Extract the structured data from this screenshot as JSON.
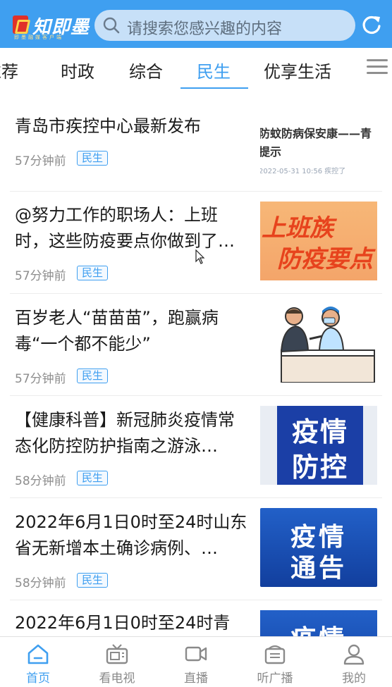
{
  "header": {
    "logo_text": "知即墨",
    "logo_subtitle": "即墨融媒客户端",
    "search_placeholder": "请搜索您感兴趣的内容"
  },
  "tabs": [
    {
      "label": "推荐",
      "active": false
    },
    {
      "label": "时政",
      "active": false
    },
    {
      "label": "综合",
      "active": false
    },
    {
      "label": "民生",
      "active": true
    },
    {
      "label": "优享生活",
      "active": false
    }
  ],
  "news": [
    {
      "title": "青岛市疾控中心最新发布",
      "time": "57分钟前",
      "tag": "民生",
      "thumb_lines": [
        "防蚊防病保安康——青",
        "提示",
        "2022-05-31 10:56 疾控了"
      ]
    },
    {
      "title": "@努力工作的职场人：上班时，这些防疫要点你做到了…",
      "time": "57分钟前",
      "tag": "民生",
      "thumb_lines": [
        "上班族",
        "防疫要点"
      ]
    },
    {
      "title": "百岁老人“苗苗苗”，跑赢病毒“一个都不能少”",
      "time": "57分钟前",
      "tag": "民生",
      "thumb_lines": []
    },
    {
      "title": "【健康科普】新冠肺炎疫情常态化防控防护指南之游泳…",
      "time": "58分钟前",
      "tag": "民生",
      "thumb_lines": [
        "疫情",
        "防控"
      ]
    },
    {
      "title": "2022年6月1日0时至24时山东省无新增本土确诊病例、…",
      "time": "58分钟前",
      "tag": "民生",
      "thumb_lines": [
        "疫情",
        "通告"
      ]
    },
    {
      "title": "2022年6月1日0时至24时青",
      "time": "",
      "tag": "",
      "thumb_lines": [
        "疫情"
      ]
    }
  ],
  "bottom_nav": [
    {
      "label": "首页",
      "icon": "home-icon",
      "active": true
    },
    {
      "label": "看电视",
      "icon": "tv-icon",
      "active": false
    },
    {
      "label": "直播",
      "icon": "video-camera-icon",
      "active": false
    },
    {
      "label": "听广播",
      "icon": "radio-icon",
      "active": false
    },
    {
      "label": "我的",
      "icon": "user-icon",
      "active": false
    }
  ],
  "colors": {
    "brand_blue": "#3f9ff0",
    "badge_blue": "#3f9ff0",
    "nav_inactive": "#8a8a8a"
  }
}
